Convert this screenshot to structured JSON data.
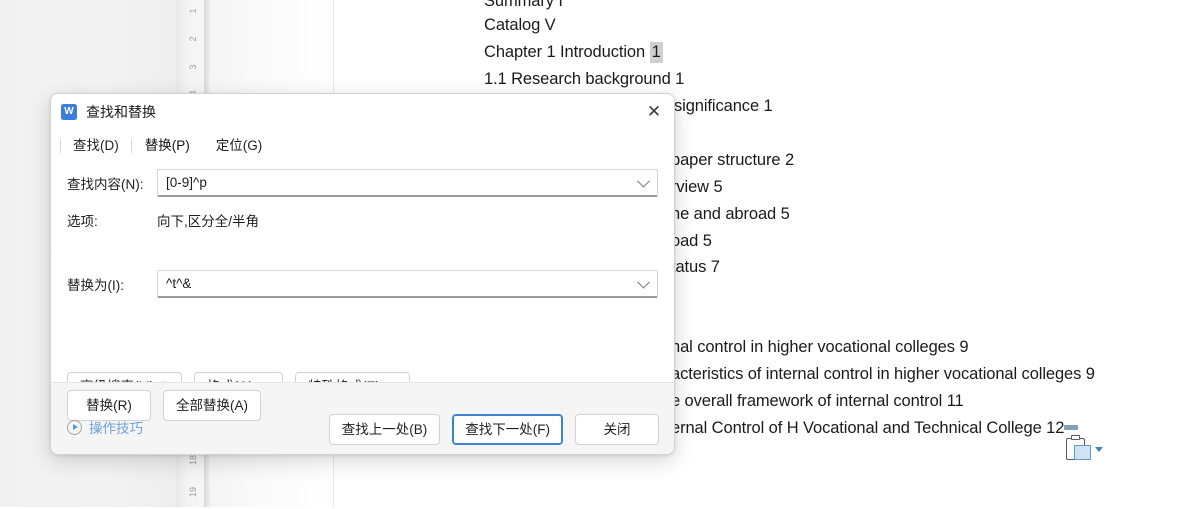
{
  "document": {
    "ruler_ticks_top": [
      "1",
      "2",
      "3",
      "4"
    ],
    "ruler_ticks_bottom": [
      "18",
      "19"
    ],
    "lines": [
      {
        "text": "Summary I",
        "selected": ""
      },
      {
        "text": "Catalog V",
        "selected": ""
      },
      {
        "text": "Chapter 1 Introduction ",
        "selected": "1"
      },
      {
        "text": "1.1 Research background 1",
        "selected": ""
      },
      {
        "text": "significance 1",
        "selected": ""
      },
      {
        "text": "paper structure 2",
        "selected": ""
      },
      {
        "text": "rview 5",
        "selected": ""
      },
      {
        "text": "ne and abroad 5",
        "selected": ""
      },
      {
        "text": "oad 5",
        "selected": ""
      },
      {
        "text": "tatus 7",
        "selected": ""
      },
      {
        "text": "nal control in higher vocational colleges 9",
        "selected": ""
      },
      {
        "text": "acteristics of internal control in higher vocational colleges 9",
        "selected": ""
      },
      {
        "text": "e overall framework of internal control 11",
        "selected": ""
      },
      {
        "text": "ernal Control of H Vocational and Technical College 12",
        "selected": ""
      }
    ],
    "paste_icon_name": "paste-options-clipboard-icon"
  },
  "dialog": {
    "app_icon_letter": "W",
    "title": "查找和替换",
    "close_glyph": "✕",
    "tabs": [
      {
        "label": "查找(D)",
        "active": false
      },
      {
        "label": "替换(P)",
        "active": true
      },
      {
        "label": "定位(G)",
        "active": false
      }
    ],
    "find": {
      "label": "查找内容(N):",
      "value": "[0-9]^p",
      "placeholder": ""
    },
    "options": {
      "label": "选项:",
      "value": "向下,区分全/半角"
    },
    "replace": {
      "label": "替换为(I):",
      "value": "^t^&",
      "placeholder": ""
    },
    "format_buttons": [
      {
        "label": "高级搜索(M)",
        "arrow": "updown"
      },
      {
        "label": "格式(O)",
        "arrow": "caret"
      },
      {
        "label": "特殊格式(E)",
        "arrow": "caret"
      }
    ],
    "replace_buttons": [
      {
        "label": "替换(R)"
      },
      {
        "label": "全部替换(A)"
      }
    ],
    "tips": {
      "label": "操作技巧",
      "color": "#6aa3de"
    },
    "footer_buttons": [
      {
        "label": "查找上一处(B)",
        "focused": false
      },
      {
        "label": "查找下一处(F)",
        "focused": true
      },
      {
        "label": "关闭",
        "focused": false
      }
    ]
  },
  "colors": {
    "accent": "#3b7ddd",
    "focus_border": "#3b85d0",
    "link": "#6aa3de",
    "selection": "#cfcfcf"
  }
}
